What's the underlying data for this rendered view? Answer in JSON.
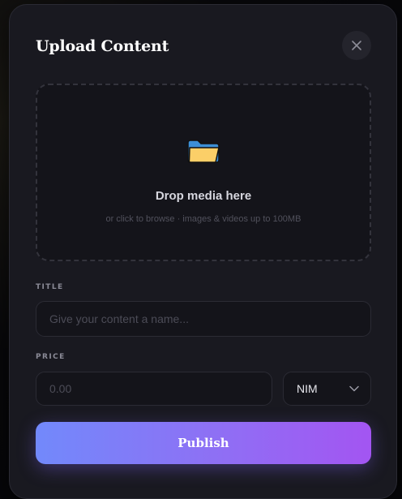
{
  "modal": {
    "title": "Upload Content",
    "close_icon": "close-icon"
  },
  "dropzone": {
    "icon": "folder-icon",
    "title": "Drop media here",
    "subtitle": "or click to browse · images & videos up to 100MB"
  },
  "title_field": {
    "label": "TITLE",
    "value": "",
    "placeholder": "Give your content a name..."
  },
  "price_field": {
    "label": "PRICE",
    "value": "",
    "placeholder": "0.00"
  },
  "currency_select": {
    "selected": "NIM",
    "icon": "chevron-down-icon"
  },
  "publish_button": {
    "label": "Publish"
  },
  "colors": {
    "modal_bg": "#191920",
    "accent_start": "#7289fb",
    "accent_end": "#a355f2",
    "folder": "#f9cf6b"
  }
}
